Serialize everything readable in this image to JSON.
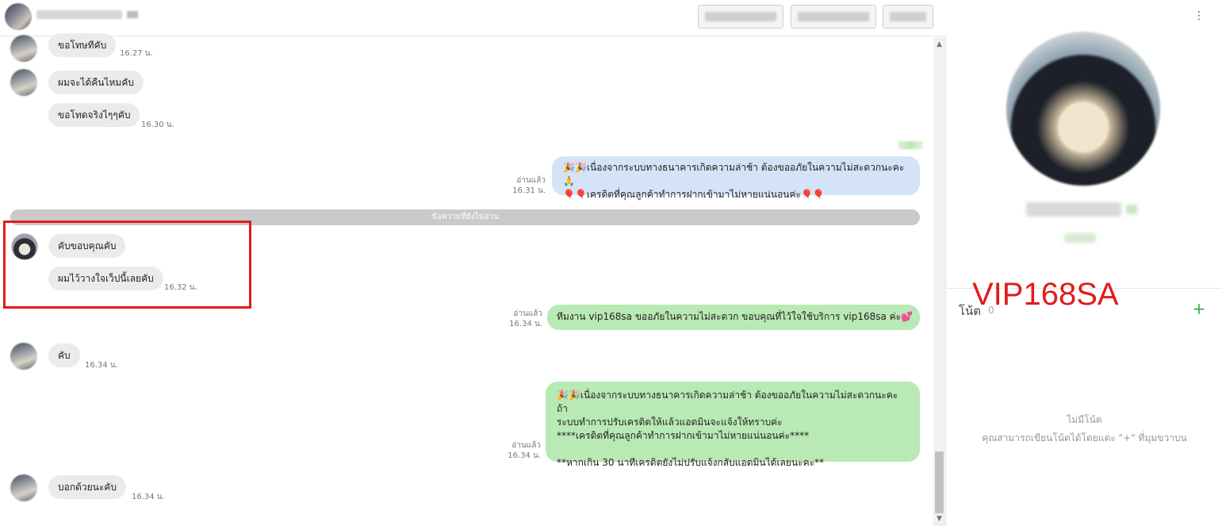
{
  "messages": [
    {
      "text": "ขอโทษทีคับ",
      "time": "16.27 น."
    },
    {
      "text": "ผมจะได้คืนไหมคับ"
    },
    {
      "text": "ขอโทดจริงไๆๆคับ",
      "time": "16.30 น."
    },
    {
      "text": "🎉🎉เนื่องจากระบบทางธนาคารเกิดความล่าช้า ต้องขออภัยในความไม่สะดวกนะคะ🙏\n🎈🎈เครดิตที่คุณลูกค้าทำการฝากเข้ามาไม่หายแน่นอนค่ะ🎈🎈",
      "read": "อ่านแล้ว",
      "time": "16.31 น."
    },
    {
      "text": "คับขอบคุณคับ"
    },
    {
      "text": "ผมไว้วางใจเว็ปนี้เลยคับ",
      "time": "16.32 น."
    },
    {
      "text": "ทีมงาน vip168sa ขออภัยในความไม่สะดวก ขอบคุณที่ไว้ใจใช้บริการ vip168sa ค่ะ💕",
      "read": "อ่านแล้ว",
      "time": "16.34 น."
    },
    {
      "text": "คับ",
      "time": "16.34 น."
    },
    {
      "text": "🎉🎉เนื่องจากระบบทางธนาคารเกิดความล่าช้า ต้องขออภัยในความไม่สะดวกนะคะ ถ้า\nระบบทำการปรับเครดิตให้แล้วแอดมินจะแจ้งให้ทราบค่ะ\n****เครดิตที่คุณลูกค้าทำการฝากเข้ามาไม่หายแน่นอนค่ะ****\n\n**หากเกิน 30 นาทีเครดิตยังไม่ปรับแจ้งกลับแอดมินได้เลยนะคะ**",
      "read": "อ่านแล้ว",
      "time": "16.34 น."
    },
    {
      "text": "บอกด้วยนะคับ",
      "time": "16.34 น."
    }
  ],
  "unread_divider": "ข้อความที่ยังไม่อ่าน",
  "scroll": {
    "up": "▲",
    "down": "▼"
  },
  "profile": {
    "watermark": "VIP168SA",
    "note_label": "โน้ต",
    "note_count": "0",
    "add_icon": "+",
    "more_icon": "⋮",
    "empty_title": "ไม่มีโน้ต",
    "empty_hint": "คุณสามารถเขียนโน้ตได้โดยแตะ \"+\" ที่มุมขวาบน"
  },
  "colors": {
    "incoming": "#ebebeb",
    "outgoing_blue": "#d4e3f7",
    "outgoing_green": "#b9e9b5",
    "highlight": "#e11b1b",
    "accent": "#2bb24a"
  }
}
